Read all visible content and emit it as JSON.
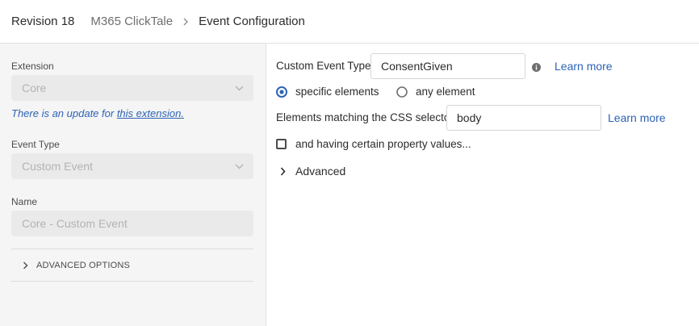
{
  "breadcrumb": {
    "revision": "Revision 18",
    "property": "M365 ClickTale",
    "current": "Event Configuration"
  },
  "sidebar": {
    "extension_label": "Extension",
    "extension_value": "Core",
    "update_text": "There is an update for ",
    "update_link": "this extension.",
    "event_type_label": "Event Type",
    "event_type_value": "Custom Event",
    "name_label": "Name",
    "name_placeholder": "Core - Custom Event",
    "advanced_options": "ADVANCED OPTIONS"
  },
  "main": {
    "custom_event_type_label": "Custom Event Type",
    "custom_event_type_value": "ConsentGiven",
    "learn_more_1": "Learn more",
    "radio_specific": "specific elements",
    "radio_any": "any element",
    "selected_radio": "specific elements",
    "css_selector_label": "Elements matching the CSS selector",
    "css_selector_value": "body",
    "learn_more_2": "Learn more",
    "property_values_checkbox": "and having certain property values...",
    "advanced_label": "Advanced"
  },
  "colors": {
    "accent": "#2d63b5",
    "link": "#2d63b5"
  },
  "icons": {
    "breadcrumb_separator": "chevron-right-icon",
    "select_arrow": "chevron-down-icon",
    "expand": "chevron-right-icon",
    "info": "info-icon"
  }
}
